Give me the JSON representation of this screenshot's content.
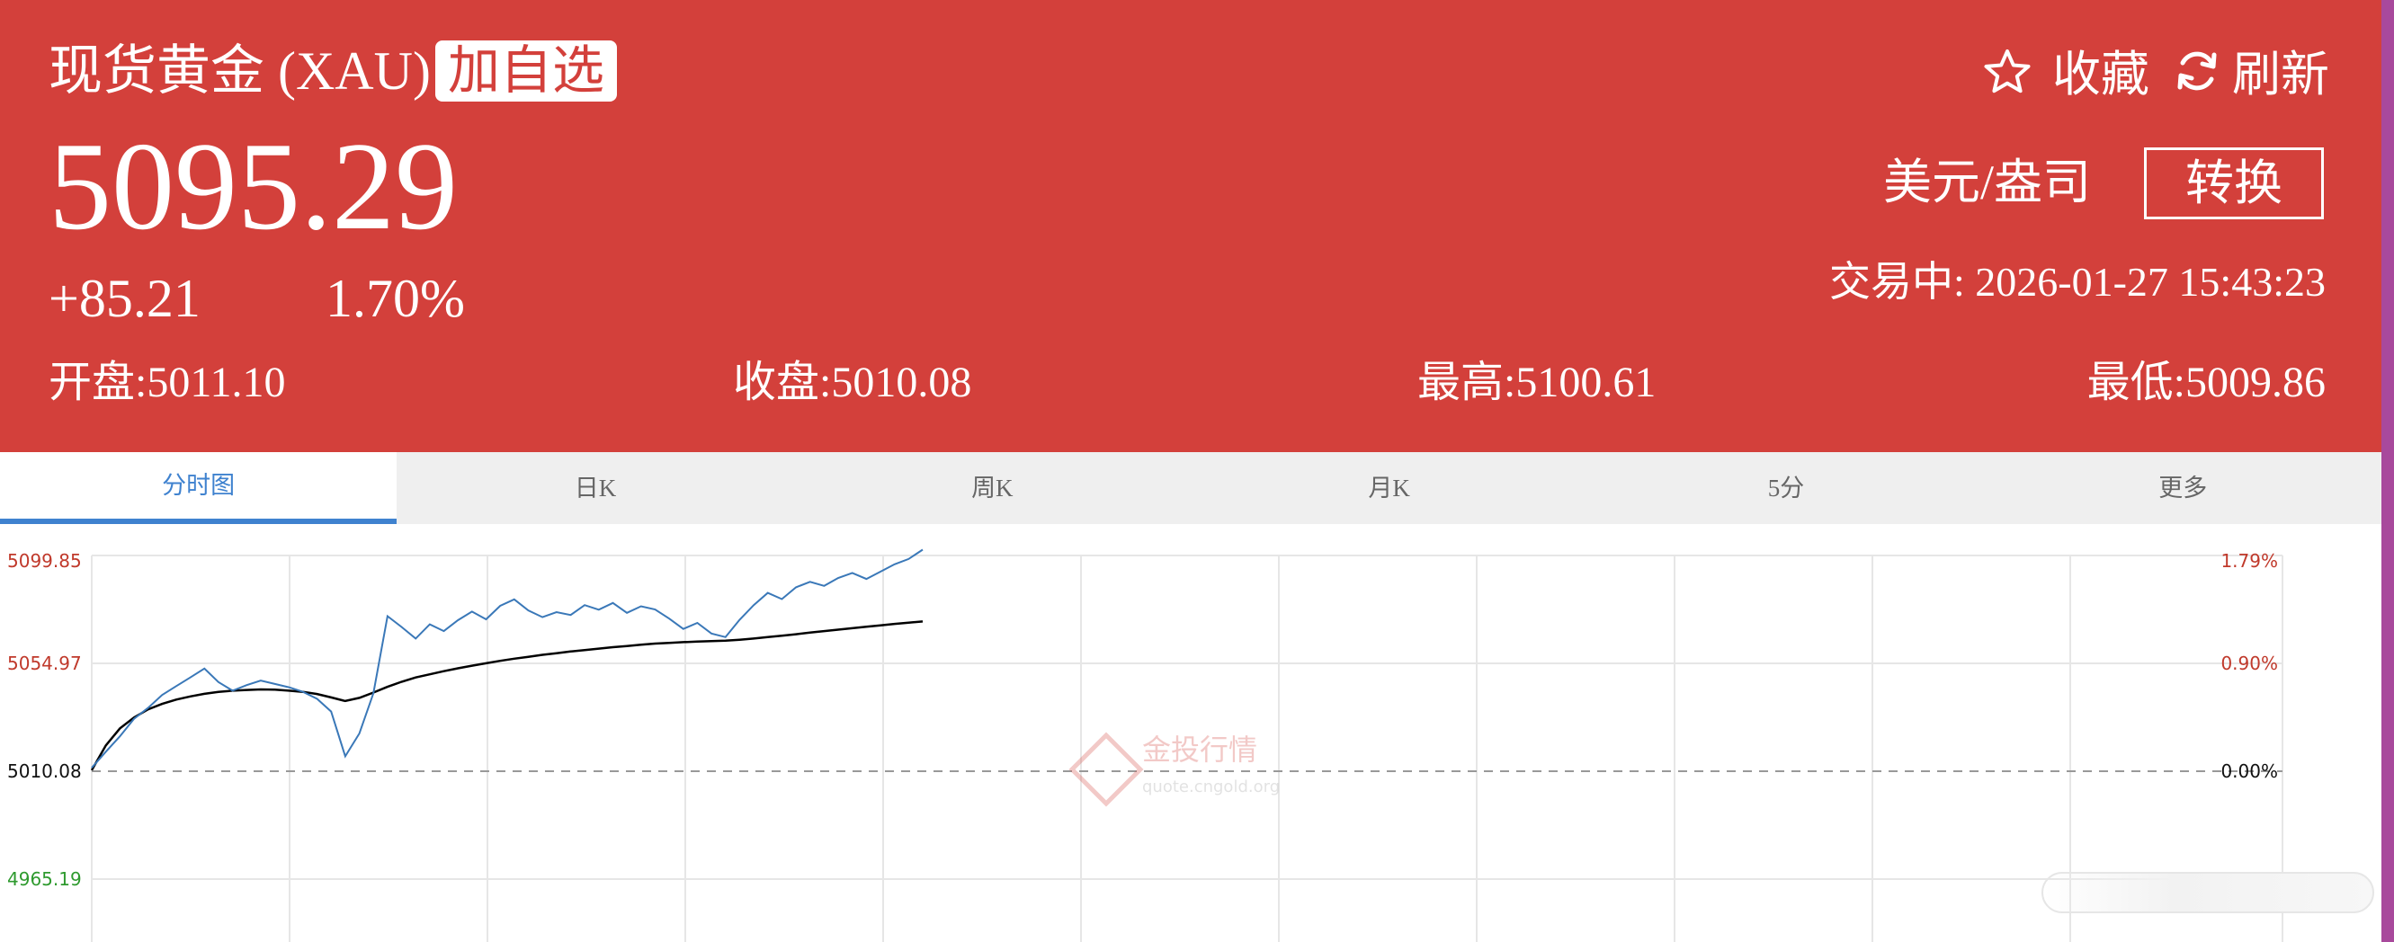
{
  "header": {
    "title": "现货黄金 (XAU)",
    "add_watchlist": "加自选",
    "price": "5095.29",
    "change": "+85.21",
    "change_pct": "1.70%",
    "favorite_label": "收藏",
    "refresh_label": "刷新",
    "unit": "美元/盎司",
    "convert_label": "转换",
    "status": "交易中:  2026-01-27 15:43:23",
    "stats": {
      "open": "开盘:5011.10",
      "close": "收盘:5010.08",
      "high": "最高:5100.61",
      "low": "最低:5009.86"
    },
    "colors": {
      "background": "#d3403b",
      "text": "#ffffff"
    }
  },
  "tabs": [
    {
      "label": "分时图",
      "active": true
    },
    {
      "label": "日K",
      "active": false
    },
    {
      "label": "周K",
      "active": false
    },
    {
      "label": "月K",
      "active": false
    },
    {
      "label": "5分",
      "active": false
    },
    {
      "label": "更多",
      "active": false
    }
  ],
  "chart": {
    "left_labels": [
      "5099.85",
      "5054.97",
      "5010.08",
      "4965.19"
    ],
    "right_labels": [
      "1.79%",
      "0.90%",
      "0.00%"
    ],
    "watermark_title": "金投行情",
    "watermark_url": "quote.cngold.org",
    "colors": {
      "up": "#c0392b",
      "base": "#111111",
      "down": "#2e9a2e",
      "price_line": "#3a78b8",
      "avg_line": "#000000"
    }
  },
  "chart_data": {
    "type": "line",
    "ylim": [
      4965.19,
      5099.85
    ],
    "baseline": 5010.08,
    "series": [
      {
        "values": [
          5011.5,
          5018.2,
          5024.6,
          5031.9,
          5036.4,
          5041.8,
          5045.5,
          5049.1,
          5052.8,
          5047.2,
          5043.6,
          5045.9,
          5047.8,
          5046.4,
          5045.0,
          5043.1,
          5040.2,
          5034.9,
          5016.3,
          5025.8,
          5042.5,
          5074.6,
          5070.1,
          5065.3,
          5071.2,
          5068.4,
          5072.9,
          5076.5,
          5073.3,
          5078.9,
          5081.6,
          5077.0,
          5074.2,
          5076.3,
          5075.1,
          5079.2,
          5077.3,
          5080.1,
          5076.0,
          5078.7,
          5077.4,
          5073.6,
          5069.3,
          5071.8,
          5067.4,
          5065.9,
          5073.1,
          5079.2,
          5084.3,
          5081.7,
          5086.6,
          5088.9,
          5087.2,
          5090.5,
          5092.6,
          5090.1,
          5093.1,
          5096.2,
          5098.4,
          5102.3
        ]
      },
      {
        "values": [
          5010.5,
          5020.8,
          5027.9,
          5032.4,
          5035.8,
          5038.1,
          5039.9,
          5041.2,
          5042.3,
          5043.1,
          5043.6,
          5043.9,
          5044.1,
          5044.0,
          5043.6,
          5043.1,
          5042.2,
          5040.8,
          5039.3,
          5040.6,
          5042.8,
          5045.2,
          5047.3,
          5049.1,
          5050.4,
          5051.7,
          5052.9,
          5054.0,
          5055.0,
          5056.0,
          5056.9,
          5057.7,
          5058.5,
          5059.2,
          5059.9,
          5060.5,
          5061.1,
          5061.7,
          5062.2,
          5062.7,
          5063.2,
          5063.5,
          5063.8,
          5064.0,
          5064.2,
          5064.4,
          5064.8,
          5065.3,
          5065.9,
          5066.5,
          5067.1,
          5067.8,
          5068.4,
          5069.0,
          5069.6,
          5070.2,
          5070.8,
          5071.4,
          5071.9,
          5072.4
        ]
      }
    ]
  }
}
